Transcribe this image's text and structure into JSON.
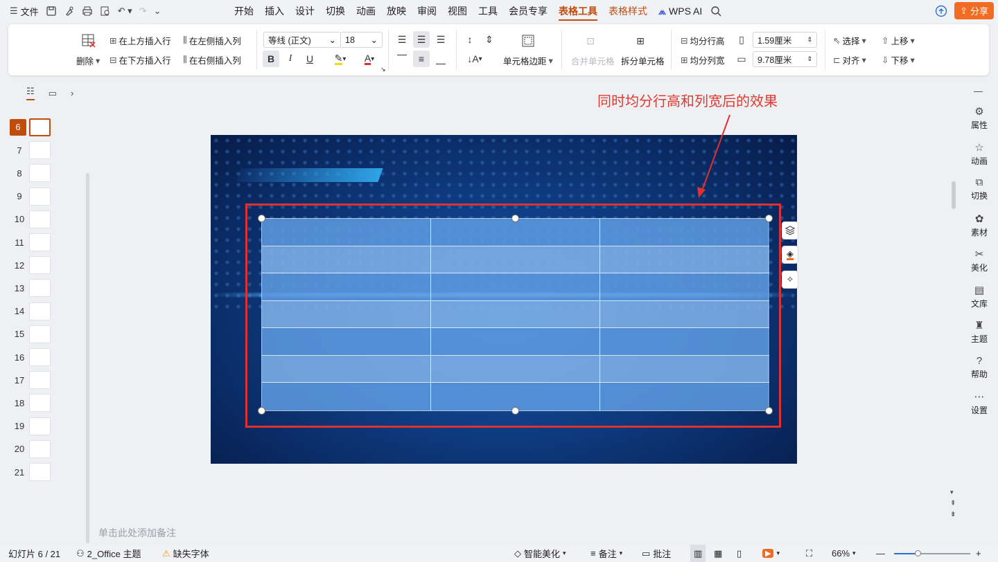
{
  "topbar": {
    "menu_label": "文件",
    "tabs": [
      "开始",
      "插入",
      "设计",
      "切换",
      "动画",
      "放映",
      "审阅",
      "视图",
      "工具",
      "会员专享",
      "表格工具",
      "表格样式"
    ],
    "active_tab": "表格工具",
    "wps_ai": "WPS AI",
    "share": "分享"
  },
  "ribbon": {
    "delete": "删除",
    "insert_above": "在上方插入行",
    "insert_below": "在下方插入行",
    "insert_left": "在左侧插入列",
    "insert_right": "在右侧插入列",
    "font": "等线 (正文)",
    "size": "18",
    "bold": "B",
    "italic": "I",
    "underline": "U",
    "font_color": "A",
    "cell_margin": "单元格边距",
    "merge_cells": "合并单元格",
    "split_cells": "拆分单元格",
    "dist_rows": "均分行高",
    "dist_cols": "均分列宽",
    "row_height": "1.59厘米",
    "col_width": "9.78厘米",
    "select": "选择",
    "align": "对齐",
    "move_up": "上移",
    "move_down": "下移"
  },
  "thumbs": [
    "6",
    "7",
    "8",
    "9",
    "10",
    "11",
    "12",
    "13",
    "14",
    "15",
    "16",
    "17",
    "18",
    "19",
    "20",
    "21"
  ],
  "current_slide": "6",
  "annotation": "同时均分行高和列宽后的效果",
  "notes_placeholder": "单击此处添加备注",
  "rightbar": [
    {
      "label": "属性",
      "icon": "sliders-icon"
    },
    {
      "label": "动画",
      "icon": "star-icon"
    },
    {
      "label": "切换",
      "icon": "transition-icon"
    },
    {
      "label": "素材",
      "icon": "material-icon"
    },
    {
      "label": "美化",
      "icon": "beautify-icon"
    },
    {
      "label": "文库",
      "icon": "library-icon"
    },
    {
      "label": "主题",
      "icon": "theme-icon"
    },
    {
      "label": "帮助",
      "icon": "help-icon"
    },
    {
      "label": "设置",
      "icon": "more-icon"
    }
  ],
  "status": {
    "slide_count": "幻灯片 6 / 21",
    "theme": "2_Office 主题",
    "missing_font": "缺失字体",
    "smart": "智能美化",
    "notes": "备注",
    "comments": "批注",
    "zoom": "66%"
  },
  "colors": {
    "accent": "#c14d0d",
    "share": "#f26b22",
    "annotation": "#e03a2f"
  }
}
